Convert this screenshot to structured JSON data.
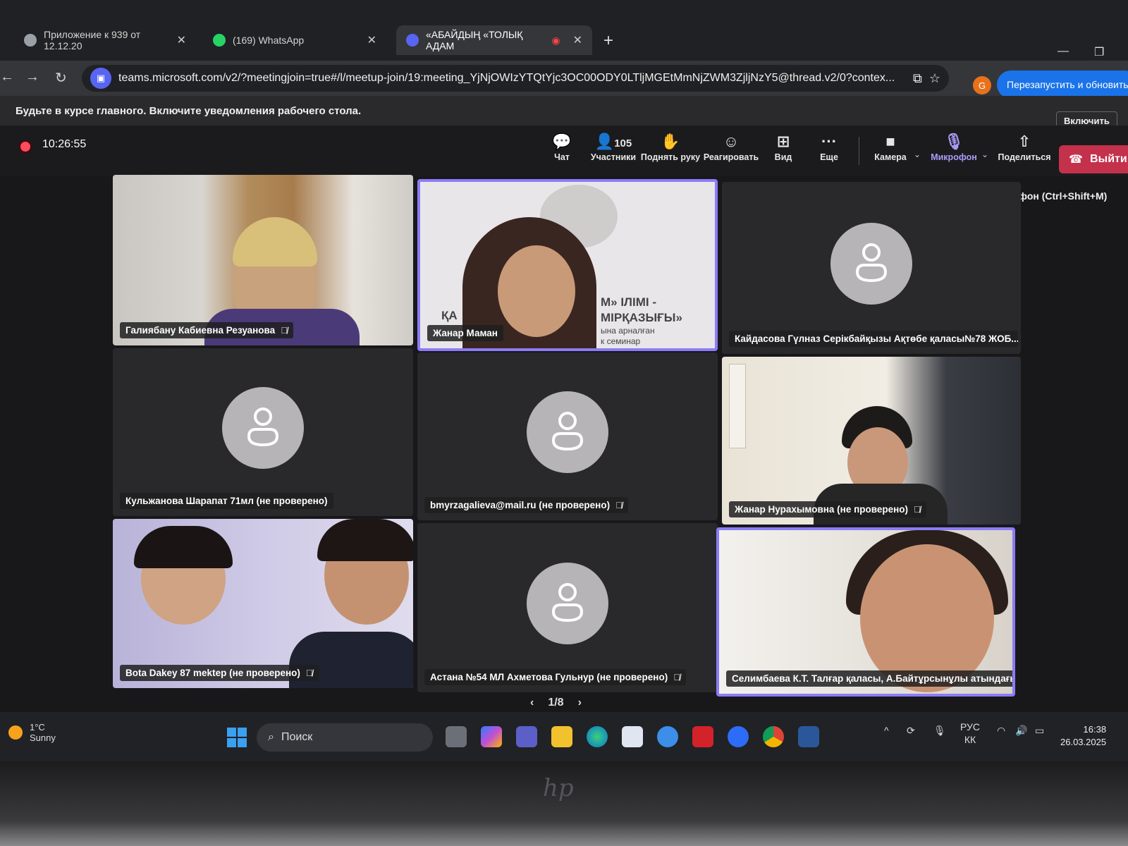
{
  "browser": {
    "tabs": [
      {
        "title": "Приложение к 939 от 12.12.20",
        "color": "#9aa0a6"
      },
      {
        "title": "(169) WhatsApp",
        "color": "#25d366"
      },
      {
        "title": "«АБАЙДЫҢ «ТОЛЫҚ АДАМ",
        "color": "#5865f2"
      }
    ],
    "url": "teams.microsoft.com/v2/?meetingjoin=true#/l/meetup-join/19:meeting_YjNjOWIzYTQtYjc3OC00ODY0LTljMGEtMmNjZWM3ZjljNzY5@thread.v2/0?contex...",
    "profile_initial": "G",
    "update_button": "Перезапустить и обновить",
    "notification": "Будьте в курсе главного. Включите уведомления рабочего стола.",
    "notification_button": "Включить"
  },
  "meeting": {
    "timer": "10:26:55",
    "toolbar": {
      "chat": "Чат",
      "participants": "Участники",
      "participants_count": "105",
      "raise_hand": "Поднять руку",
      "react": "Реагировать",
      "view": "Вид",
      "more": "Еще",
      "camera": "Камера",
      "mic": "Микрофон",
      "share": "Поделиться",
      "leave": "Выйти"
    },
    "mic_tooltip": "Включить микрофон (Ctrl+Shift+M)",
    "tiles": [
      {
        "name": "Галиябану Кабиевна Резуанова",
        "muted": true
      },
      {
        "name": "Жанар Маман",
        "muted": false
      },
      {
        "name": "Кайдасова Гүлназ Серікбайқызы Ақтөбе қаласы№78 ЖОБ...",
        "muted": false
      },
      {
        "name": "Кульжанова Шарапат 71мл (не проверено)",
        "muted": false
      },
      {
        "name": "bmyrzagalieva@mail.ru (не проверено)",
        "muted": true
      },
      {
        "name": "Жанар Нурахымовна (не проверено)",
        "muted": true
      },
      {
        "name": "Bota Dakey 87 mektep (не проверено)",
        "muted": true
      },
      {
        "name": "Астана №54 МЛ Ахметова Гульнур (не проверено)",
        "muted": true
      },
      {
        "name": "Селимбаева К.Т. Талғар қаласы, А.Байтұрсынұлы атындағы...",
        "muted": false
      }
    ],
    "pager": "1/8",
    "slide_text": {
      "line1": "ҚА",
      "line2": "М» ІЛІМІ -",
      "line3": "МІРҚАЗЫҒЫ»",
      "line4": "ына арналған",
      "line5": "к семинар"
    }
  },
  "taskbar": {
    "temperature": "1°C",
    "weather": "Sunny",
    "search_placeholder": "Поиск",
    "language": "РУС",
    "language_sub": "КК",
    "time": "16:38",
    "date": "26.03.2025"
  },
  "colors": {
    "accent": "#8b7cf6",
    "leave": "#c4314b",
    "record": "#ff4b5c"
  }
}
